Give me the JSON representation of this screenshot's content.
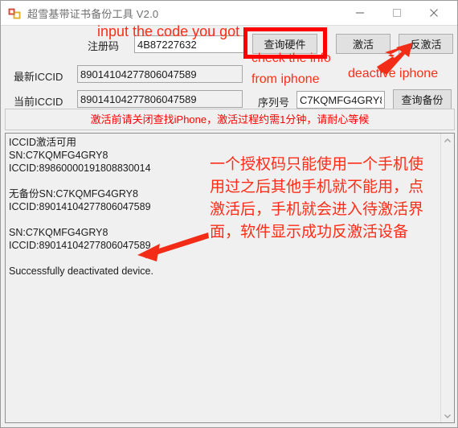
{
  "window": {
    "title": "超雪基带证书备份工具 V2.0",
    "icon": "app-window-icon",
    "controls": {
      "minimize": "minimize-icon",
      "maximize": "maximize-icon",
      "close": "close-icon"
    }
  },
  "form": {
    "reg_label": "注册码",
    "reg_value": "4B87227632",
    "latest_iccid_label": "最新ICCID",
    "latest_iccid_value": "89014104277806047589",
    "current_iccid_label": "当前ICCID",
    "current_iccid_value": "89014104277806047589",
    "serial_label": "序列号",
    "serial_value": "C7KQMFG4GRY8"
  },
  "buttons": {
    "query_hardware": "查询硬件",
    "activate": "激活",
    "deactivate": "反激活",
    "query_backup": "查询备份"
  },
  "banner": {
    "text": "激活前请关闭查找iPhone，激活过程约需1分钟，请耐心等候",
    "color": "#ff0000"
  },
  "log": {
    "text": "ICCID激活可用\nSN:C7KQMFG4GRY8\nICCID:89860000191808830014\n\n无备份SN:C7KQMFG4GRY8\nICCID:89014104277806047589\n\nSN:C7KQMFG4GRY8\nICCID:89014104277806047589\n\nSuccessfully deactivated device.",
    "scrollbar": {
      "up_arrow": "chevron-up-icon",
      "down_arrow": "chevron-down-icon"
    }
  },
  "annotations": {
    "color": "#ff2d18",
    "input_code": "input the code you got",
    "check_info": "check the info",
    "from_iphone": "from iphone",
    "deactive_iphone": "deactive iphone",
    "note_block": "一个授权码只能使用一个手机使用过之后其他手机就不能用，点激活后，手机就会进入待激活界面，软件显示成功反激活设备",
    "highlight_box_color": "#ff0000"
  }
}
